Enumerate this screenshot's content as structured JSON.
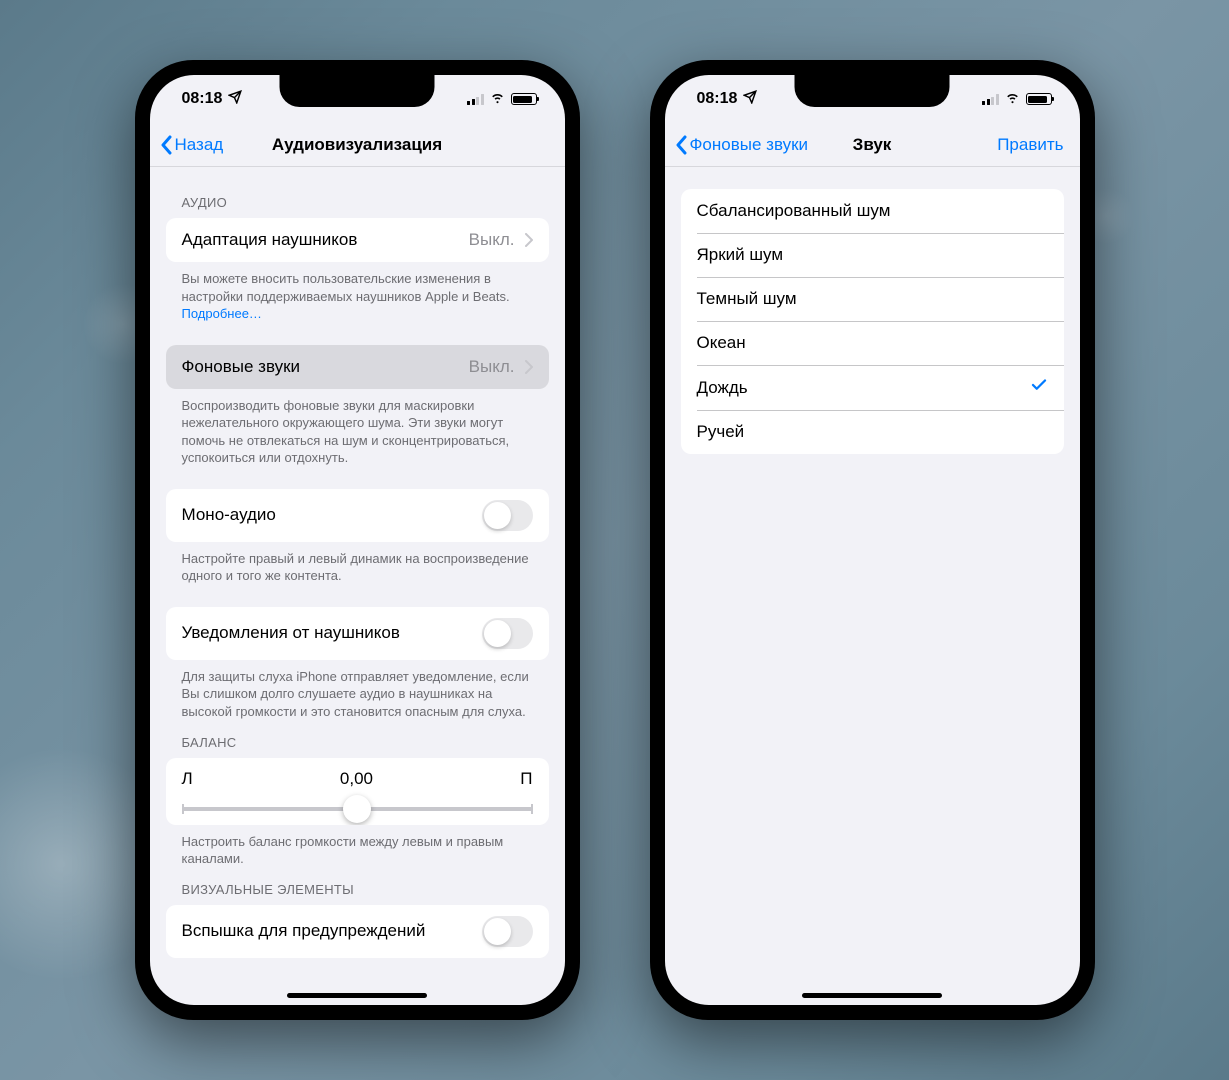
{
  "status": {
    "time": "08:18"
  },
  "left_phone": {
    "nav_back": "Назад",
    "nav_title": "Аудиовизуализация",
    "section_audio": "АУДИО",
    "row_headphone_adapt": "Адаптация наушников",
    "row_headphone_adapt_value": "Выкл.",
    "footer_headphone": "Вы можете вносить пользовательские изменения в настройки поддерживаемых наушников Apple и Beats. ",
    "footer_headphone_link": "Подробнее…",
    "row_background_sounds": "Фоновые звуки",
    "row_background_sounds_value": "Выкл.",
    "footer_background": "Воспроизводить фоновые звуки для маскировки нежелательного окружающего шума. Эти звуки могут помочь не отвлекаться на шум и сконцентрироваться, успокоиться или отдохнуть.",
    "row_mono": "Моно-аудио",
    "footer_mono": "Настройте правый и левый динамик на воспроизведение одного и того же контента.",
    "row_notify": "Уведомления от наушников",
    "footer_notify": "Для защиты слуха iPhone отправляет уведомление, если Вы слишком долго слушаете аудио в наушниках на высокой громкости и это становится опасным для слуха.",
    "section_balance": "БАЛАНС",
    "balance_l": "Л",
    "balance_value": "0,00",
    "balance_r": "П",
    "footer_balance": "Настроить баланс громкости между левым и правым каналами.",
    "section_visual": "ВИЗУАЛЬНЫЕ ЭЛЕМЕНТЫ",
    "row_flash": "Вспышка для предупреждений"
  },
  "right_phone": {
    "nav_back": "Фоновые звуки",
    "nav_title": "Звук",
    "nav_right": "Править",
    "sounds": [
      "Сбалансированный шум",
      "Яркий шум",
      "Темный шум",
      "Океан",
      "Дождь",
      "Ручей"
    ],
    "selected_index": 4
  }
}
